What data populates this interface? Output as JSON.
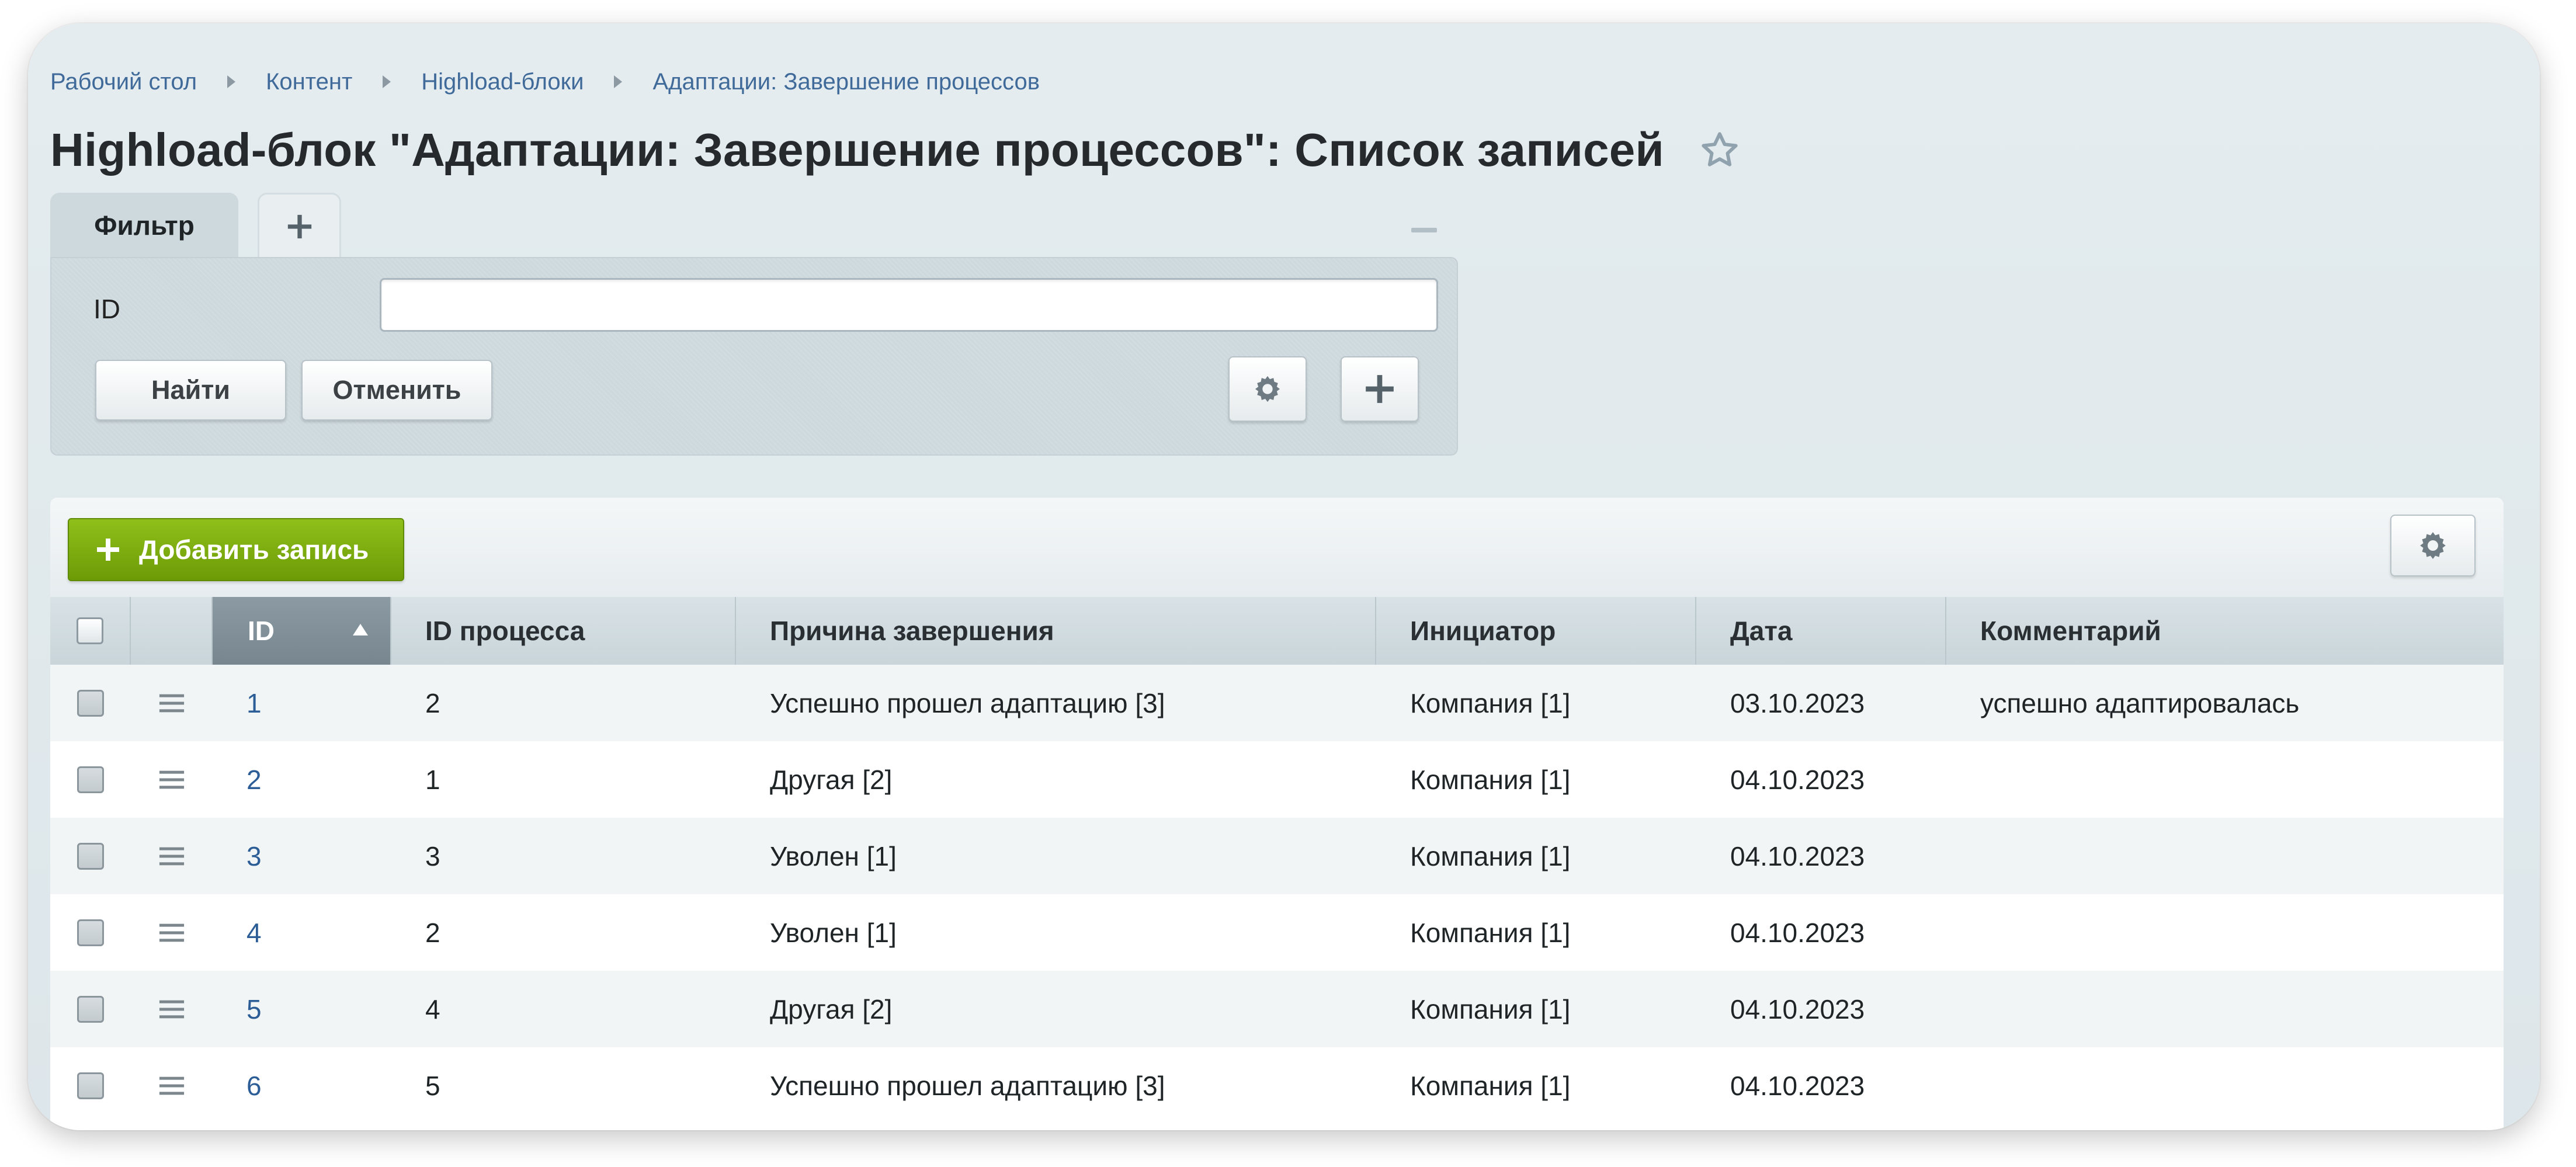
{
  "breadcrumb": [
    {
      "label": "Рабочий стол"
    },
    {
      "label": "Контент"
    },
    {
      "label": "Highload-блоки"
    },
    {
      "label": "Адаптации: Завершение процессов"
    }
  ],
  "page_title": "Highload-блок \"Адаптации: Завершение процессов\": Список записей",
  "filter": {
    "tab_label": "Фильтр",
    "field_label": "ID",
    "field_value": "",
    "find_label": "Найти",
    "cancel_label": "Отменить"
  },
  "grid": {
    "add_label": "Добавить запись",
    "columns": [
      "ID",
      "ID процесса",
      "Причина завершения",
      "Инициатор",
      "Дата",
      "Комментарий"
    ],
    "sort": {
      "column": "ID",
      "direction": "asc"
    },
    "rows": [
      {
        "id": "1",
        "process_id": "2",
        "reason": "Успешно прошел адаптацию [3]",
        "initiator": "Компания [1]",
        "date": "03.10.2023",
        "comment": "успешно адаптировалась"
      },
      {
        "id": "2",
        "process_id": "1",
        "reason": "Другая [2]",
        "initiator": "Компания [1]",
        "date": "04.10.2023",
        "comment": ""
      },
      {
        "id": "3",
        "process_id": "3",
        "reason": "Уволен [1]",
        "initiator": "Компания [1]",
        "date": "04.10.2023",
        "comment": ""
      },
      {
        "id": "4",
        "process_id": "2",
        "reason": "Уволен [1]",
        "initiator": "Компания [1]",
        "date": "04.10.2023",
        "comment": ""
      },
      {
        "id": "5",
        "process_id": "4",
        "reason": "Другая [2]",
        "initiator": "Компания [1]",
        "date": "04.10.2023",
        "comment": ""
      },
      {
        "id": "6",
        "process_id": "5",
        "reason": "Успешно прошел адаптацию [3]",
        "initiator": "Компания [1]",
        "date": "04.10.2023",
        "comment": ""
      }
    ]
  },
  "icons": {
    "breadcrumb_separator": "triangle-right-icon",
    "favorite": "star-outline-icon",
    "filter_add_tab": "plus-icon",
    "filter_minimize": "minus-icon",
    "filter_settings": "gear-icon",
    "filter_add_field": "plus-icon",
    "grid_settings": "gear-icon",
    "row_actions": "hamburger-menu-icon",
    "sort": "sort-asc-arrow-icon"
  },
  "colors": {
    "accent_green": "#7aab0d",
    "link_blue": "#2c5d96",
    "sorted_header": "#808f98",
    "background": "#e0e8ec"
  }
}
